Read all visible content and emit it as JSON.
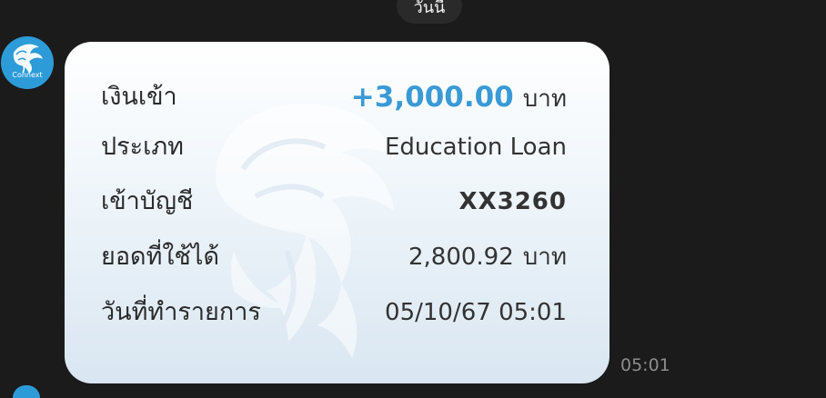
{
  "header": {
    "date_label": "วันนี้"
  },
  "sender": {
    "avatar_label": "Connext"
  },
  "message": {
    "rows": [
      {
        "label": "เงินเข้า",
        "value": "+3,000.00",
        "unit": "บาท"
      },
      {
        "label": "ประเภท",
        "value": "Education Loan"
      },
      {
        "label": "เข้าบัญชี",
        "value": "XX3260"
      },
      {
        "label": "ยอดที่ใช้ได้",
        "value": "2,800.92",
        "unit": "บาท"
      },
      {
        "label": "วันที่ทำรายการ",
        "value": "05/10/67 05:01"
      }
    ],
    "time": "05:01"
  },
  "colors": {
    "background": "#1b1b1b",
    "accent": "#3a9ad6",
    "brand": "#2e9bd9"
  },
  "icons": {
    "avatar": "krungthai-bird-logo-icon",
    "watermark": "krungthai-bird-watermark-icon"
  }
}
